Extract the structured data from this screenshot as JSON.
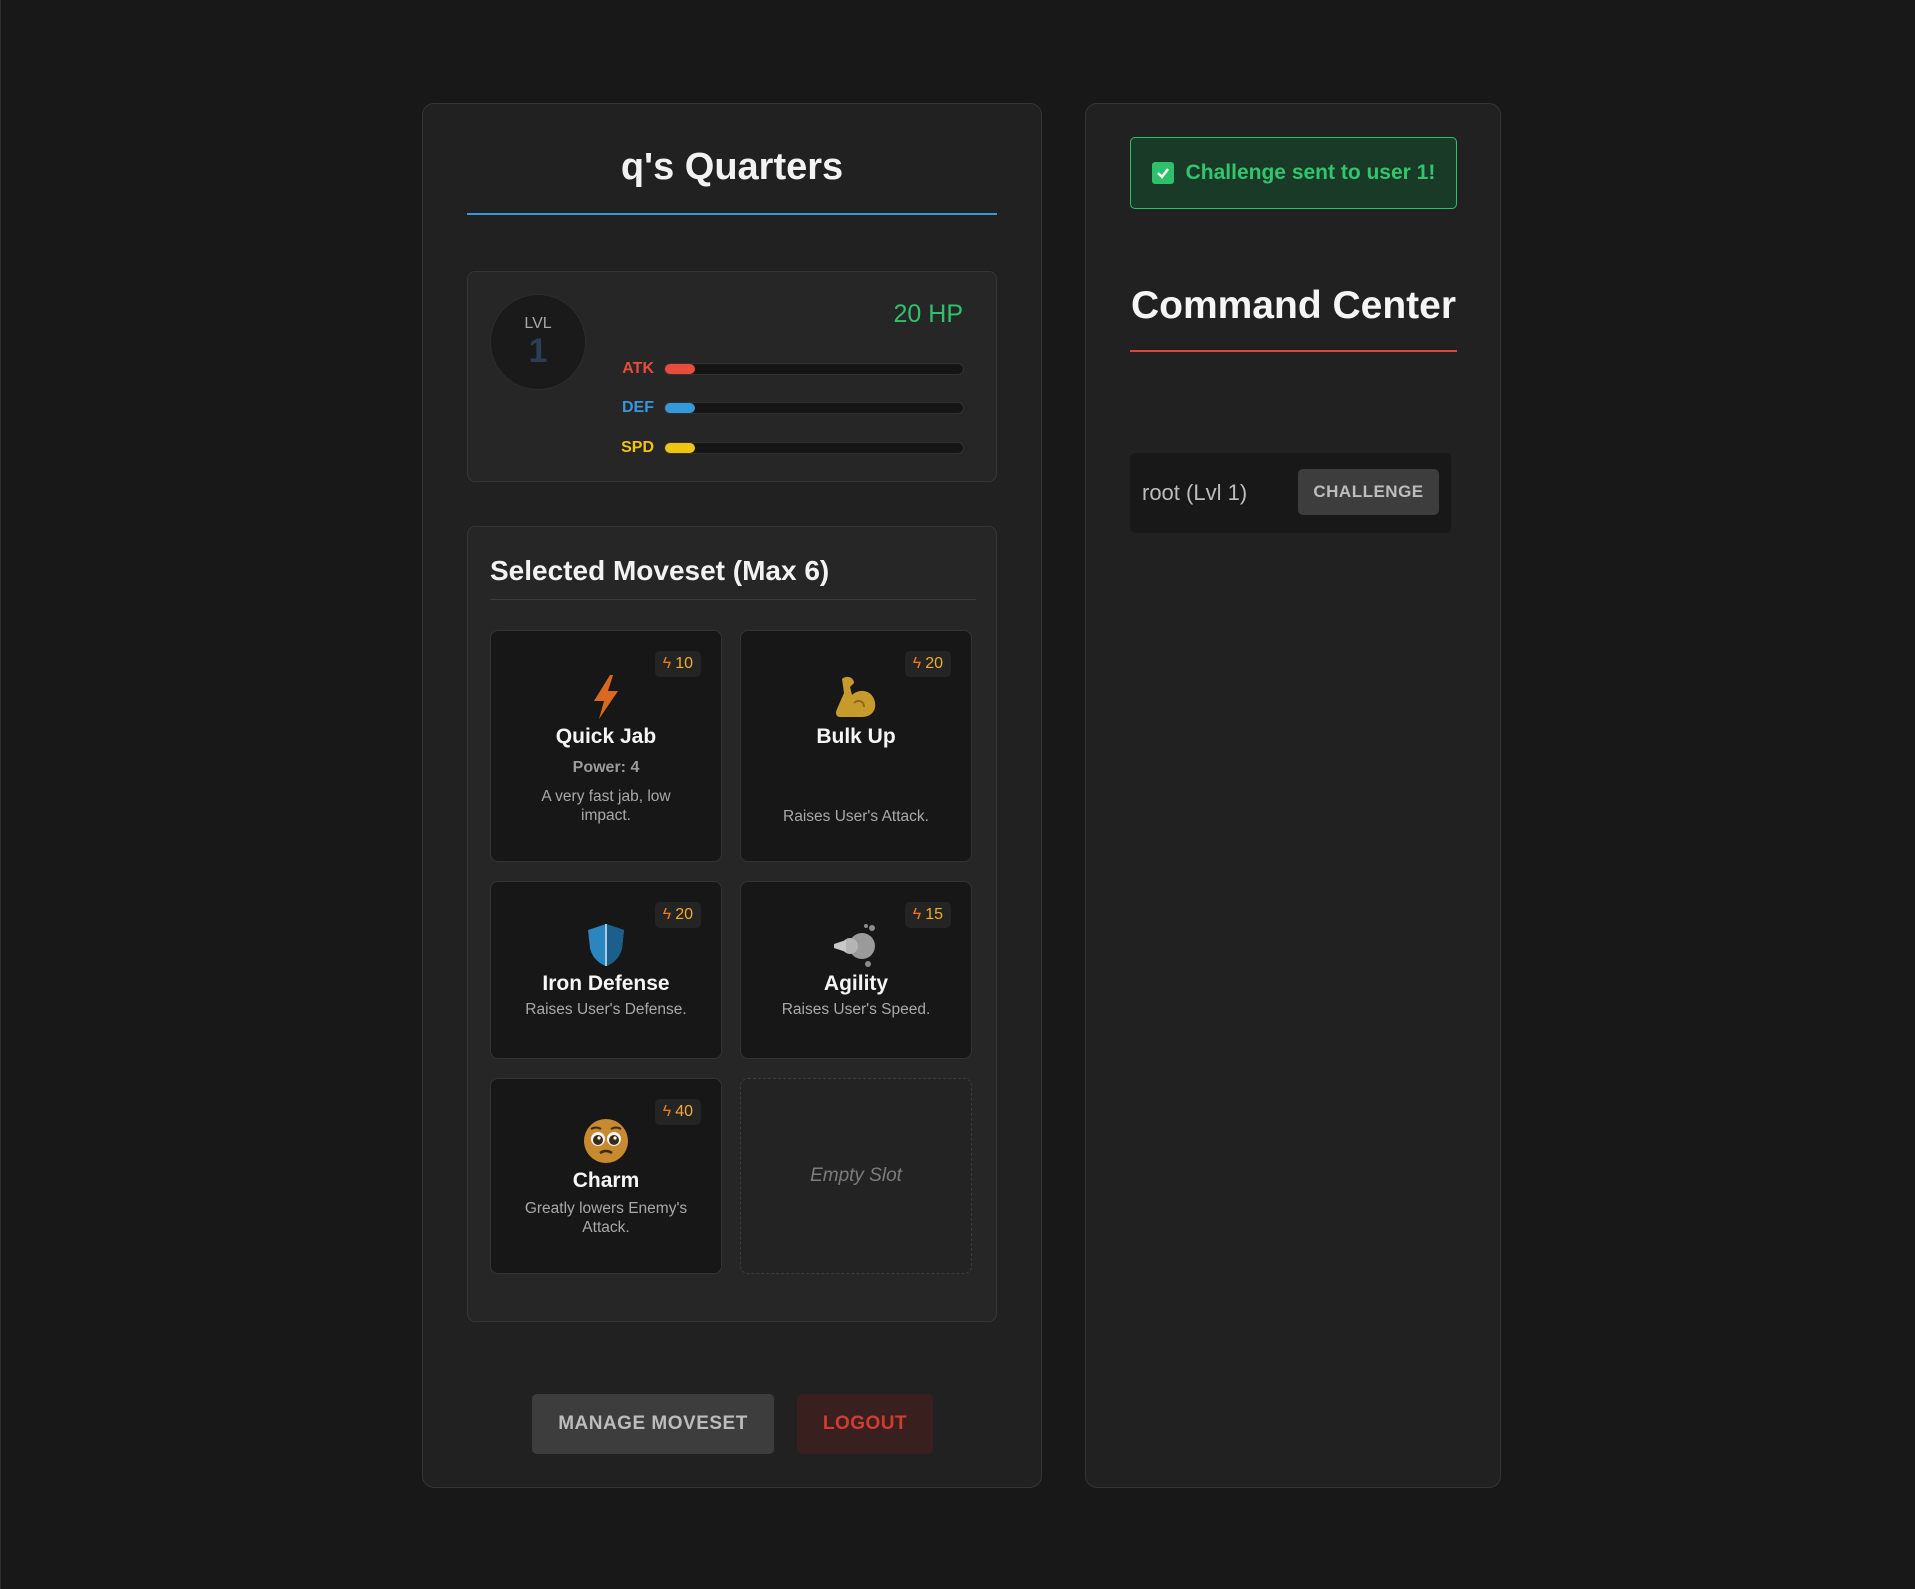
{
  "quarters": {
    "title": "q's Quarters",
    "level_label": "LVL",
    "level": "1",
    "hp": "20 HP",
    "stats": [
      {
        "label": "ATK",
        "color": "#e74c3c",
        "fill": 0.1
      },
      {
        "label": "DEF",
        "color": "#3498db",
        "fill": 0.1
      },
      {
        "label": "SPD",
        "color": "#f1c40f",
        "fill": 0.1
      }
    ]
  },
  "moveset": {
    "title": "Selected Moveset (Max 6)",
    "moves": [
      {
        "name": "Quick Jab",
        "cost": "10",
        "power": "Power: 4",
        "desc": "A very fast jab, low impact.",
        "icon": "lightning-icon"
      },
      {
        "name": "Bulk Up",
        "cost": "20",
        "power": "",
        "desc": "Raises User's Attack.",
        "icon": "flexed-bicep-icon"
      },
      {
        "name": "Iron Defense",
        "cost": "20",
        "power": "",
        "desc": "Raises User's Defense.",
        "icon": "shield-icon"
      },
      {
        "name": "Agility",
        "cost": "15",
        "power": "",
        "desc": "Raises User's Speed.",
        "icon": "dash-icon"
      },
      {
        "name": "Charm",
        "cost": "40",
        "power": "",
        "desc": "Greatly lowers Enemy's Attack.",
        "icon": "pleading-face-icon"
      }
    ],
    "empty_slot": "Empty Slot"
  },
  "actions": {
    "manage": "MANAGE MOVESET",
    "logout": "LOGOUT"
  },
  "command_center": {
    "toast": "Challenge sent to user 1!",
    "title": "Command Center",
    "users": [
      {
        "name": "root (Lvl 1)",
        "button": "CHALLENGE"
      }
    ]
  }
}
